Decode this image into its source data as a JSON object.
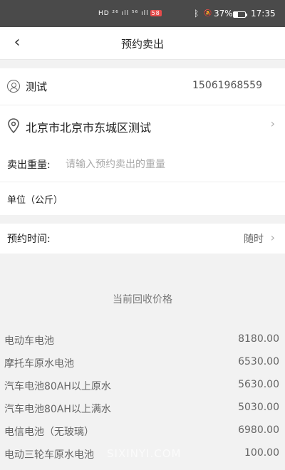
{
  "status_bar": {
    "signal_text": "HD ²⁶ ıll ⁵⁶ ıll",
    "badge": "58",
    "bluetooth": "ᛒ",
    "mute": "🔕",
    "battery_pct": "37%",
    "battery_level": 0.37,
    "time": "17:35"
  },
  "nav": {
    "back": "‹",
    "title": "预约卖出"
  },
  "contact": {
    "name": "测试",
    "phone": "15061968559",
    "address": "北京市北京市东城区测试",
    "chevron": "›"
  },
  "weight": {
    "label": "卖出重量:",
    "placeholder": "请输入预约卖出的重量",
    "value": "",
    "unit_label": "单位（公斤）"
  },
  "appointment": {
    "label": "预约时间:",
    "value": "随时",
    "chevron": "›"
  },
  "price_list": {
    "title": "当前回收价格",
    "items": [
      {
        "name": "电动车电池",
        "price": "8180.00"
      },
      {
        "name": "摩托车原水电池",
        "price": "6530.00"
      },
      {
        "name": "汽车电池80AH以上原水",
        "price": "5630.00"
      },
      {
        "name": "汽车电池80AH以上满水",
        "price": "5030.00"
      },
      {
        "name": "电信电池（无玻璃）",
        "price": "6980.00"
      },
      {
        "name": "电动三轮车原水电池",
        "price": "100.00"
      }
    ]
  },
  "watermark": "SIXINYI.COM"
}
